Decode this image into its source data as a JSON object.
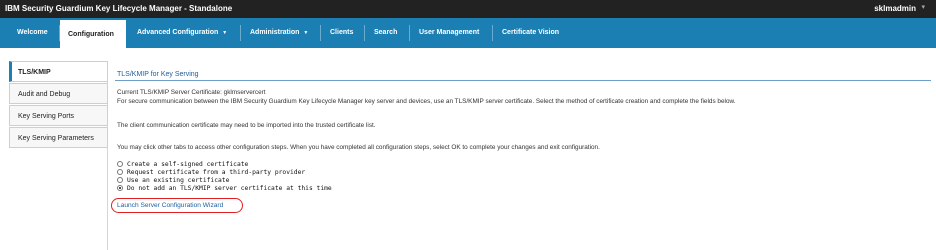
{
  "app": {
    "title": "IBM Security Guardium Key Lifecycle Manager - Standalone",
    "user": "sklmadmin",
    "user_caret": "▾"
  },
  "nav": {
    "items": [
      {
        "label": "Welcome"
      },
      {
        "label": "Configuration",
        "active": true
      },
      {
        "label": "Advanced Configuration",
        "dropdown": true
      },
      {
        "label": "Administration",
        "dropdown": true
      },
      {
        "label": "Clients"
      },
      {
        "label": "Search"
      },
      {
        "label": "User Management"
      },
      {
        "label": "Certificate Vision"
      }
    ],
    "caret": "▼"
  },
  "sidebar": {
    "items": [
      {
        "label": "TLS/KMIP",
        "active": true
      },
      {
        "label": "Audit and Debug"
      },
      {
        "label": "Key Serving Ports"
      },
      {
        "label": "Key Serving Parameters"
      }
    ]
  },
  "main": {
    "section_title": "TLS/KMIP for Key Serving",
    "current_cert": "Current TLS/KMIP Server Certificate: gklmservercert",
    "intro": "For secure communication between the IBM Security Guardium Key Lifecycle Manager key server and devices, use an TLS/KMIP server certificate. Select the method of certificate creation and complete the fields below.",
    "import_note": "The client communication certificate may need to be imported into the trusted certificate list.",
    "tabs_note": "You may click other tabs to access other configuration steps. When you have completed all configuration steps, select OK to complete your changes and exit configuration.",
    "options": [
      {
        "label": "Create a self-signed certificate",
        "checked": false
      },
      {
        "label": "Request certificate from a third-party provider",
        "checked": false
      },
      {
        "label": "Use an existing certificate",
        "checked": false
      },
      {
        "label": "Do not add an TLS/KMIP server certificate at this time",
        "checked": true
      }
    ],
    "wizard_link": "Launch Server Configuration Wizard"
  },
  "colors": {
    "nav_bg": "#1b7fb4",
    "titlebar_bg": "#222222",
    "link": "#1b5f9e",
    "highlight": "#e02020"
  }
}
